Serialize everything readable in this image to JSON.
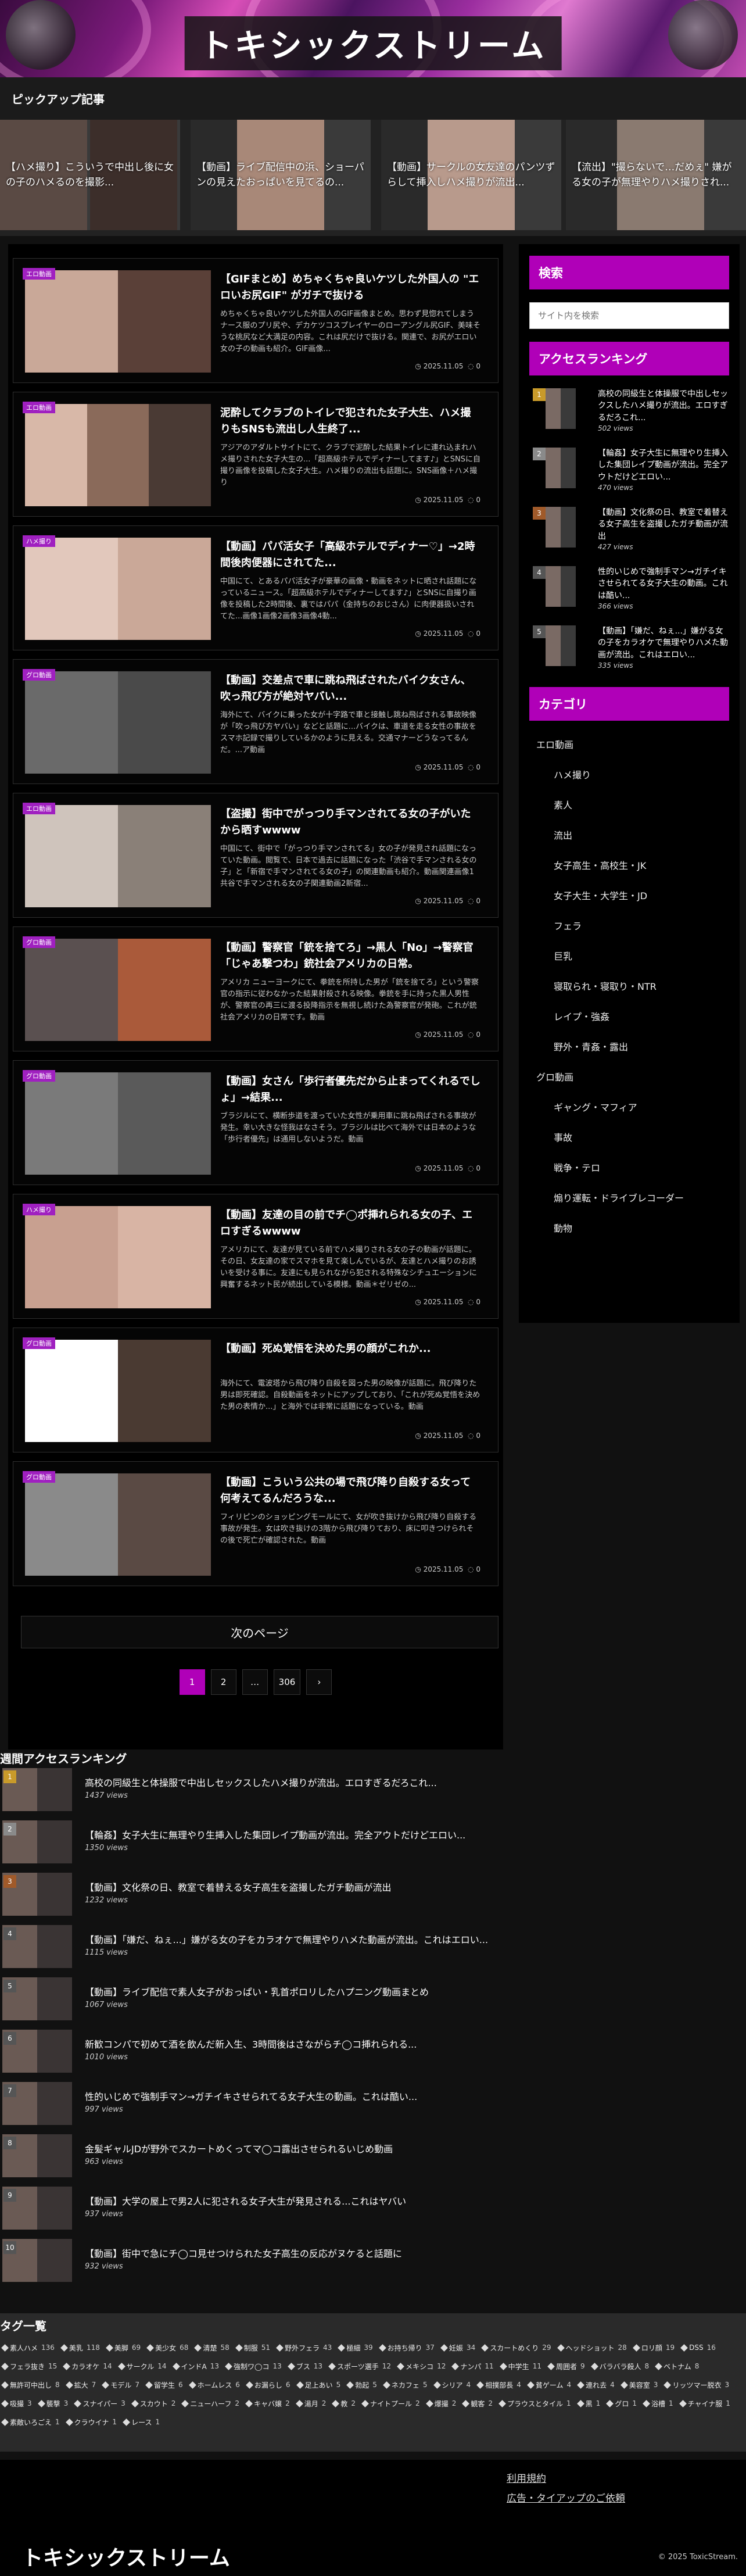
{
  "header": {
    "site_title": "トキシックストリーム"
  },
  "pickup": {
    "heading": "ピックアップ記事",
    "items": [
      "【ハメ撮り】こういうで中出し後に女の子のハメるのを撮影...",
      "【動画】ライブ配信中の浜、ショーパンの見えたおっぱいを見てるの...",
      "【動画】サークルの女友達のパンツずらして挿入しハメ撮りが流出...",
      "【流出】\"撮らないで…だめぇ\" 嫌がる女の子が無理やりハメ撮りされ..."
    ]
  },
  "articles": [
    {
      "category": "エロ動画",
      "title": "【GIFまとめ】めちゃくちゃ良いケツした外国人の \"エロいお尻GIF\" がガチで抜ける",
      "excerpt": "めちゃくちゃ良いケツした外国人のGIF画像まとめ。思わず見惚れてしまうナース服のプリ尻や、デカケツコスプレイヤーのローアングル尻GIF、美味そうな桃尻など大満足の内容。これは尻だけで抜ける。関連で、お尻がエロい女の子の動画も紹介。GIF画像...",
      "date": "2025.11.05",
      "comments": "0"
    },
    {
      "category": "エロ動画",
      "title": "泥酔してクラブのトイレで犯された女子大生、ハメ撮りもSNSも流出し人生終了...",
      "excerpt": "アジアのアダルトサイトにて、クラブで泥酔した結果トイレに連れ込まれハメ撮りされた女子大生の...「超高級ホテルでディナーしてます♪」とSNSに自撮り画像を投稿した女子大生。ハメ撮りの流出も話題に。SNS画像＋ハメ撮り",
      "date": "2025.11.05",
      "comments": "0"
    },
    {
      "category": "ハメ撮り",
      "title": "【動画】パパ活女子「高級ホテルでディナー♡」→2時間後肉便器にされてた...",
      "excerpt": "中国にて、とあるパパ活女子が豪華の画像・動画をネットに晒され話題になっているニュース。「超高級ホテルでディナーしてます♪」とSNSに自撮り画像を投稿した2時間後、裏ではパパ（金持ちのおじさん）に肉便器扱いされてた...画像1画像2画像3画像4動...",
      "date": "2025.11.05",
      "comments": "0"
    },
    {
      "category": "グロ動画",
      "title": "【動画】交差点で車に跳ね飛ばされたバイク女さん、吹っ飛び方が絶対ヤバい...",
      "excerpt": "海外にて、バイクに乗った女が十字路で車と接触し跳ね飛ばされる事故映像が「吹っ飛び方ヤバい」などと話題に...バイクは、車道を走る女性の事故をスマホ記録で撮りしているかのように見える。交通マナーどうなってるんだ。...ア動画",
      "date": "2025.11.05",
      "comments": "0"
    },
    {
      "category": "エロ動画",
      "title": "【盗撮】街中でがっつり手マンされてる女の子がいたから晒すwwww",
      "excerpt": "中国にて、街中で「がっつり手マンされてる」女の子が発見され話題になっていた動画。閲覧で、日本で過去に話題になった「渋谷で手マンされる女の子」と「新宿で手マンされてる女の子」の関連動画も紹介。動画関連画像1共谷で手マンされる女の子関連動画2新宿...",
      "date": "2025.11.05",
      "comments": "0"
    },
    {
      "category": "グロ動画",
      "title": "【動画】警察官「銃を捨てろ」→黒人「No」→警察官「じゃあ撃つわ」銃社会アメリカの日常。",
      "excerpt": "アメリカ ニューヨークにて、拳銃を所持した男が「銃を捨てろ」という警察官の指示に従わなかった結果射殺される映像。拳銃を手に持った黒人男性が、警察官の再三に渡る投降指示を無視し続けた為警察官が発砲。これが銃社会アメリカの日常です。動画",
      "date": "2025.11.05",
      "comments": "0"
    },
    {
      "category": "グロ動画",
      "title": "【動画】女さん「歩行者優先だから止まってくれるでしょ」→結果...",
      "excerpt": "ブラジルにて、横断歩道を渡っていた女性が乗用車に跳ね飛ばされる事故が発生。幸い大きな怪我はなさそう。ブラジルは比べて海外では日本のような「歩行者優先」は通用しないようだ。動画",
      "date": "2025.11.05",
      "comments": "0"
    },
    {
      "category": "ハメ撮り",
      "title": "【動画】友達の目の前でチ◯ポ挿れられる女の子、エロすぎるwwww",
      "excerpt": "アメリカにて、友達が見ている前でハメ撮りされる女の子の動画が話題に。その日、女友達の家でスマホを見て楽しんでいるが、友達とハメ撮りのお誘いを受ける事に。友達にも見られながら犯される特殊なシチュエーションに興奮するネット民が続出している模様。動画＊ゼリゼの...",
      "date": "2025.11.05",
      "comments": "0"
    },
    {
      "category": "グロ動画",
      "title": "【動画】死ぬ覚悟を決めた男の顔がこれか...",
      "excerpt": "海外にて、電波塔から飛び降り自殺を図った男の映像が話題に。飛び降りた男は即死確認。自殺動画をネットにアップしており、「これが死ぬ覚悟を決めた男の表情か...」と海外では非常に話題になっている。動画",
      "date": "2025.11.05",
      "comments": "0"
    },
    {
      "category": "グロ動画",
      "title": "【動画】こういう公共の場で飛び降り自殺する女って何考えてるんだろうな...",
      "excerpt": "フィリピンのショッピングモールにて、女が吹き抜けから飛び降り自殺する事故が発生。女は吹き抜けの3階から飛び降りており、床に叩きつけられその後で死亡が確認された。動画",
      "date": "2025.11.05",
      "comments": "0"
    }
  ],
  "next_page_label": "次のページ",
  "pagination": [
    "1",
    "2",
    "…",
    "306",
    "›"
  ],
  "sidebar": {
    "search_heading": "検索",
    "search_placeholder": "サイト内を検索",
    "ranking_heading": "アクセスランキング",
    "ranking": [
      {
        "title": "高校の同級生と体操服で中出しセックスしたハメ撮りが流出。エロすぎるだろこれ...",
        "views": "502 views"
      },
      {
        "title": "【輪姦】女子大生に無理やり生挿入した集団レイプ動画が流出。完全アウトだけどエロい...",
        "views": "470 views"
      },
      {
        "title": "【動画】文化祭の日、教室で着替える女子高生を盗撮したガチ動画が流出",
        "views": "427 views"
      },
      {
        "title": "性的いじめで強制手マン→ガチイキさせられてる女子大生の動画。これは酷い...",
        "views": "366 views"
      },
      {
        "title": "【動画】「嫌だ、ねぇ...」嫌がる女の子をカラオケで無理やりハメた動画が流出。これはエロい...",
        "views": "335 views"
      }
    ],
    "category_heading": "カテゴリ",
    "categories": [
      {
        "label": "エロ動画",
        "level": "top"
      },
      {
        "label": "ハメ撮り",
        "level": "sub"
      },
      {
        "label": "素人",
        "level": "sub"
      },
      {
        "label": "流出",
        "level": "sub"
      },
      {
        "label": "女子高生・高校生・JK",
        "level": "sub"
      },
      {
        "label": "女子大生・大学生・JD",
        "level": "sub"
      },
      {
        "label": "フェラ",
        "level": "sub"
      },
      {
        "label": "巨乳",
        "level": "sub"
      },
      {
        "label": "寝取られ・寝取り・NTR",
        "level": "sub"
      },
      {
        "label": "レイプ・強姦",
        "level": "sub"
      },
      {
        "label": "野外・青姦・露出",
        "level": "sub"
      },
      {
        "label": "グロ動画",
        "level": "top"
      },
      {
        "label": "ギャング・マフィア",
        "level": "sub"
      },
      {
        "label": "事故",
        "level": "sub"
      },
      {
        "label": "戦争・テロ",
        "level": "sub"
      },
      {
        "label": "煽り運転・ドライブレコーダー",
        "level": "sub"
      },
      {
        "label": "動物",
        "level": "sub"
      }
    ]
  },
  "weekly": {
    "heading": "週間アクセスランキング",
    "items": [
      {
        "title": "高校の同級生と体操服で中出しセックスしたハメ撮りが流出。エロすぎるだろこれ...",
        "views": "1437 views"
      },
      {
        "title": "【輪姦】女子大生に無理やり生挿入した集団レイプ動画が流出。完全アウトだけどエロい...",
        "views": "1350 views"
      },
      {
        "title": "【動画】文化祭の日、教室で着替える女子高生を盗撮したガチ動画が流出",
        "views": "1232 views"
      },
      {
        "title": "【動画】「嫌だ、ねぇ...」嫌がる女の子をカラオケで無理やりハメた動画が流出。これはエロい...",
        "views": "1115 views"
      },
      {
        "title": "【動画】ライブ配信で素人女子がおっぱい・乳首ポロリしたハプニング動画まとめ",
        "views": "1067 views"
      },
      {
        "title": "新歓コンパで初めて酒を飲んだ新入生、3時間後はさながらチ◯コ挿れられる...",
        "views": "1010 views"
      },
      {
        "title": "性的いじめで強制手マン→ガチイキさせられてる女子大生の動画。これは酷い...",
        "views": "997 views"
      },
      {
        "title": "金髪ギャルJDが野外でスカートめくってマ◯コ露出させられるいじめ動画",
        "views": "963 views"
      },
      {
        "title": "【動画】大学の屋上で男2人に犯される女子大生が発見される...これはヤバい",
        "views": "937 views"
      },
      {
        "title": "【動画】街中で急にチ◯コ見せつけられた女子高生の反応がヌケると話題に",
        "views": "932 views"
      }
    ]
  },
  "tags": {
    "heading": "タグ一覧",
    "items": [
      [
        "素人ハメ",
        "136"
      ],
      [
        "美乳",
        "118"
      ],
      [
        "美脚",
        "69"
      ],
      [
        "美少女",
        "68"
      ],
      [
        "清楚",
        "58"
      ],
      [
        "制服",
        "51"
      ],
      [
        "野外フェラ",
        "43"
      ],
      [
        "極細",
        "39"
      ],
      [
        "お持ち帰り",
        "37"
      ],
      [
        "妊娠",
        "34"
      ],
      [
        "スカートめくり",
        "29"
      ],
      [
        "ヘッドショット",
        "28"
      ],
      [
        "ロリ顔",
        "19"
      ],
      [
        "DSS",
        "16"
      ],
      [
        "フェラ抜き",
        "15"
      ],
      [
        "カラオケ",
        "14"
      ],
      [
        "サークル",
        "14"
      ],
      [
        "インドA",
        "13"
      ],
      [
        "強制ワ◯コ",
        "13"
      ],
      [
        "ブス",
        "13"
      ],
      [
        "スポーツ選手",
        "12"
      ],
      [
        "メキシコ",
        "12"
      ],
      [
        "ナンパ",
        "11"
      ],
      [
        "中学生",
        "11"
      ],
      [
        "周囲者",
        "9"
      ],
      [
        "バラバラ殺人",
        "8"
      ],
      [
        "ベトナム",
        "8"
      ],
      [
        "無許可中出し",
        "8"
      ],
      [
        "拡大",
        "7"
      ],
      [
        "モデル",
        "7"
      ],
      [
        "留学生",
        "6"
      ],
      [
        "ホームレス",
        "6"
      ],
      [
        "お漏らし",
        "6"
      ],
      [
        "足上あい",
        "5"
      ],
      [
        "勃起",
        "5"
      ],
      [
        "ネカフェ",
        "5"
      ],
      [
        "シリア",
        "4"
      ],
      [
        "相撲部長",
        "4"
      ],
      [
        "貧ゲーム",
        "4"
      ],
      [
        "連れ去",
        "4"
      ],
      [
        "美容室",
        "3"
      ],
      [
        "リッツマー脱衣",
        "3"
      ],
      [
        "吸撮",
        "3"
      ],
      [
        "襲撃",
        "3"
      ],
      [
        "スナイパー",
        "3"
      ],
      [
        "スカウト",
        "2"
      ],
      [
        "ニューハーフ",
        "2"
      ],
      [
        "キャバ嬢",
        "2"
      ],
      [
        "湯月",
        "2"
      ],
      [
        "教",
        "2"
      ],
      [
        "ナイトプール",
        "2"
      ],
      [
        "爆撮",
        "2"
      ],
      [
        "観客",
        "2"
      ],
      [
        "プラウスとタイル",
        "1"
      ],
      [
        "黒",
        "1"
      ],
      [
        "グロ",
        "1"
      ],
      [
        "浴槽",
        "1"
      ],
      [
        "チャイナ服",
        "1"
      ],
      [
        "素敵いろごえ",
        "1"
      ],
      [
        "クラウイナ",
        "1"
      ],
      [
        "レース",
        "1"
      ]
    ]
  },
  "footer": {
    "links": [
      "利用規約",
      "広告・タイアップのご依頼"
    ],
    "title": "トキシックストリーム",
    "copyright": "© 2025 ToxicStream."
  },
  "colors": {
    "accent": "#b000b8",
    "background": "#111111",
    "panel": "#000000"
  }
}
